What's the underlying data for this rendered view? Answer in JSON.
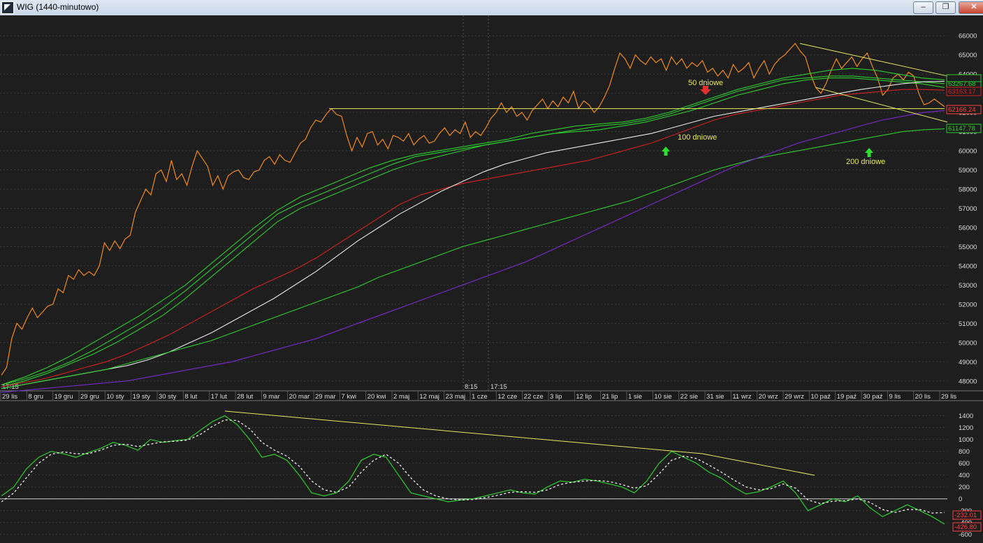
{
  "window": {
    "title": "WIG (1440-minutowo)",
    "minimize_label": "–",
    "restore_label": "❐",
    "close_label": "✕"
  },
  "chart_data": [
    {
      "type": "line",
      "yticks": [
        48000,
        49000,
        50000,
        51000,
        52000,
        53000,
        54000,
        55000,
        56000,
        57000,
        58000,
        59000,
        60000,
        61000,
        62000,
        63000,
        64000,
        65000,
        66000
      ],
      "ylim": [
        47700,
        66700
      ],
      "xlabels": [
        "29 lis",
        "8 gru",
        "19 gru",
        "29 gru",
        "10 sty",
        "19 sty",
        "30 sty",
        "8 lut",
        "17 lut",
        "28 lut",
        "9 mar",
        "20 mar",
        "29 mar",
        "7 kwi",
        "20 kwi",
        "2 maj",
        "12 maj",
        "23 maj",
        "1 cze",
        "12 cze",
        "22 cze",
        "3 lip",
        "12 lip",
        "21 lip",
        "1 sie",
        "10 sie",
        "22 sie",
        "31 sie",
        "11 wrz",
        "20 wrz",
        "29 wrz",
        "10 paź",
        "19 paź",
        "30 paź",
        "9 lis",
        "20 lis",
        "29 lis"
      ],
      "time_labels": [
        "17:15",
        "8:15",
        "17:15"
      ],
      "series": [
        {
          "key": "price",
          "color": "#f08a24",
          "values": [
            48300,
            48700,
            50200,
            51000,
            50700,
            51300,
            51800,
            51300,
            51600,
            51900,
            52000,
            52800,
            52600,
            53500,
            53300,
            53800,
            53500,
            53700,
            53500,
            54000,
            55200,
            54800,
            55300,
            54900,
            55400,
            55600,
            56800,
            57400,
            58000,
            57700,
            58800,
            59000,
            58400,
            59500,
            58500,
            58800,
            58200,
            59200,
            60000,
            59600,
            59200,
            58200,
            58700,
            58000,
            58700,
            58900,
            59000,
            58600,
            58500,
            58900,
            59000,
            59500,
            59700,
            59300,
            59800,
            59500,
            59400,
            59900,
            60400,
            60600,
            61200,
            61600,
            61500,
            61900,
            62200,
            61900,
            61800,
            60800,
            60000,
            60700,
            60200,
            60900,
            61000,
            60300,
            60600,
            60100,
            60800,
            60700,
            60500,
            60900,
            60300,
            60600,
            60800,
            60400,
            60500,
            60900,
            61200,
            60800,
            61100,
            60900,
            61500,
            60700,
            61000,
            60800,
            61200,
            61700,
            62000,
            62500,
            62000,
            62300,
            61800,
            62000,
            61600,
            62100,
            62400,
            62700,
            62200,
            62600,
            62300,
            62800,
            62500,
            63100,
            62200,
            62600,
            62400,
            62000,
            62300,
            62800,
            63400,
            64300,
            65100,
            64800,
            64300,
            65000,
            64700,
            64500,
            64900,
            64600,
            64800,
            64200,
            64900,
            64500,
            64800,
            64300,
            64600,
            64400,
            64700,
            64100,
            64300,
            63900,
            64200,
            63800,
            64500,
            64100,
            64300,
            64600,
            63800,
            64300,
            64700,
            64000,
            64500,
            64800,
            65000,
            65300,
            65600,
            65200,
            64900,
            64000,
            63300,
            63000,
            63500,
            64200,
            64800,
            64300,
            64600,
            64900,
            64400,
            64800,
            65100,
            64400,
            63800,
            62900,
            63200,
            63800,
            64000,
            63700,
            64100,
            63900,
            63000,
            62400,
            62500,
            62700,
            62500,
            62300
          ]
        },
        {
          "key": "ma-green-a",
          "color": "#2ecc2e",
          "values": [
            47800,
            48200,
            48700,
            49300,
            50000,
            50700,
            51400,
            52200,
            53000,
            54000,
            55000,
            56000,
            56900,
            57600,
            58100,
            58600,
            59100,
            59500,
            59800,
            60000,
            60200,
            60400,
            60600,
            60900,
            61100,
            61300,
            61400,
            61500,
            61700,
            62000,
            62400,
            62800,
            63200,
            63500,
            63800,
            64000,
            64200,
            64300,
            64200,
            64000,
            63800,
            63700
          ]
        },
        {
          "key": "ma-green-b",
          "color": "#2ecc2e",
          "values": [
            47800,
            48100,
            48500,
            49000,
            49600,
            50300,
            51000,
            51800,
            52700,
            53700,
            54700,
            55700,
            56700,
            57300,
            57800,
            58300,
            58800,
            59300,
            59700,
            59900,
            60100,
            60300,
            60500,
            60700,
            60900,
            61100,
            61300,
            61400,
            61600,
            61900,
            62300,
            62700,
            63100,
            63400,
            63700,
            63800,
            63900,
            63900,
            63800,
            63700,
            63600,
            63500
          ]
        },
        {
          "key": "ma-green-c",
          "color": "#2ecc2e",
          "values": [
            47700,
            48000,
            48400,
            48900,
            49400,
            50000,
            50700,
            51400,
            52300,
            53300,
            54300,
            55300,
            56300,
            57000,
            57500,
            58000,
            58500,
            59000,
            59400,
            59700,
            60000,
            60300,
            60500,
            60700,
            60900,
            61000,
            61100,
            61300,
            61500,
            61800,
            62100,
            62500,
            62900,
            63200,
            63500,
            63700,
            63800,
            63800,
            63700,
            63600,
            63500,
            63300
          ]
        },
        {
          "key": "ma-100-red",
          "color": "#d42020",
          "values": [
            47700,
            47900,
            48100,
            48400,
            48700,
            49000,
            49400,
            49900,
            50400,
            51000,
            51600,
            52200,
            52800,
            53300,
            53800,
            54400,
            55100,
            55800,
            56500,
            57200,
            57700,
            58000,
            58300,
            58500,
            58700,
            58900,
            59100,
            59300,
            59500,
            59800,
            60100,
            60400,
            60800,
            61200,
            61600,
            61900,
            62100,
            62300,
            62500,
            62700,
            62900,
            63000,
            63100,
            63200,
            63200,
            63163
          ]
        },
        {
          "key": "ma-white",
          "color": "#e8e8e8",
          "values": [
            47600,
            47800,
            48000,
            48200,
            48400,
            48600,
            48800,
            49100,
            49500,
            50000,
            50500,
            51100,
            51700,
            52300,
            53000,
            53700,
            54500,
            55300,
            56000,
            56700,
            57300,
            57900,
            58400,
            58900,
            59300,
            59600,
            59900,
            60100,
            60300,
            60500,
            60700,
            60900,
            61200,
            61500,
            61800,
            62000,
            62200,
            62400,
            62600,
            62800,
            63000,
            63200,
            63350,
            63500,
            63600,
            63620
          ]
        },
        {
          "key": "ma-200-green",
          "color": "#2ecc2e",
          "values": [
            47600,
            47800,
            48000,
            48200,
            48400,
            48600,
            48900,
            49200,
            49500,
            49800,
            50100,
            50500,
            50900,
            51300,
            51700,
            52100,
            52500,
            52900,
            53400,
            53800,
            54200,
            54600,
            55000,
            55300,
            55600,
            55900,
            56200,
            56500,
            56800,
            57100,
            57400,
            57800,
            58200,
            58600,
            59000,
            59300,
            59600,
            59800,
            60000,
            60200,
            60400,
            60600,
            60800,
            61000,
            61100,
            61147
          ]
        },
        {
          "key": "ma-purple",
          "color": "#7a2ad0",
          "values": [
            47400,
            47500,
            47600,
            47700,
            47800,
            47900,
            48000,
            48200,
            48400,
            48600,
            48800,
            49000,
            49300,
            49600,
            49900,
            50200,
            50600,
            51000,
            51400,
            51800,
            52200,
            52600,
            53000,
            53400,
            53800,
            54200,
            54700,
            55200,
            55700,
            56200,
            56700,
            57200,
            57700,
            58200,
            58700,
            59200,
            59600,
            60000,
            60400,
            60700,
            61000,
            61300,
            61600,
            61800,
            62000,
            62100
          ]
        }
      ],
      "lines": [
        {
          "key": "support-line",
          "color": "#e8e860",
          "y": 62200
        },
        {
          "key": "upper-trend",
          "color": "#e8e860",
          "from": [
            65600
          ],
          "to": [
            63900
          ]
        },
        {
          "key": "lower-trend",
          "color": "#e8e860",
          "from": [
            63300
          ],
          "to": [
            61500
          ]
        }
      ],
      "annotations": [
        {
          "key": "ma50",
          "text": "50 dniowe",
          "color": "#e8e860"
        },
        {
          "key": "ma100",
          "text": "100 dniowe",
          "color": "#e8e860"
        },
        {
          "key": "ma200",
          "text": "200 dniowe",
          "color": "#e8e860"
        }
      ],
      "value_labels": [
        {
          "text": "63267.68",
          "color": "#2ecc2e"
        },
        {
          "text": "63163.17",
          "color": "#d42020"
        },
        {
          "text": "62166.24",
          "color": "#ff4040"
        },
        {
          "text": "61147.78",
          "color": "#2ecc2e"
        }
      ]
    },
    {
      "type": "line",
      "yticks": [
        -600,
        -400,
        -200,
        0,
        200,
        400,
        600,
        800,
        1000,
        1200,
        1400
      ],
      "ylim": [
        -650,
        1560
      ],
      "series": [
        {
          "key": "macd",
          "color": "#2ecc2e",
          "values": [
            50,
            200,
            500,
            700,
            800,
            760,
            700,
            780,
            850,
            950,
            900,
            820,
            1000,
            950,
            980,
            1000,
            1150,
            1300,
            1400,
            1250,
            1000,
            700,
            750,
            650,
            400,
            100,
            50,
            100,
            300,
            650,
            750,
            700,
            400,
            100,
            50,
            0,
            -50,
            -20,
            0,
            50,
            100,
            150,
            100,
            80,
            200,
            300,
            280,
            330,
            300,
            250,
            200,
            100,
            300,
            600,
            800,
            700,
            600,
            450,
            350,
            200,
            80,
            120,
            200,
            300,
            100,
            -200,
            -100,
            0,
            -50,
            50,
            -150,
            -300,
            -200,
            -100,
            -200,
            -300,
            -427
          ]
        },
        {
          "key": "signal",
          "color": "#ffffff",
          "dashed": true,
          "values": [
            -50,
            100,
            350,
            600,
            750,
            790,
            760,
            760,
            820,
            900,
            920,
            880,
            920,
            960,
            970,
            990,
            1080,
            1220,
            1330,
            1320,
            1180,
            950,
            820,
            720,
            550,
            300,
            150,
            110,
            200,
            450,
            650,
            750,
            600,
            350,
            150,
            50,
            0,
            -20,
            -10,
            20,
            60,
            110,
            120,
            110,
            150,
            240,
            280,
            300,
            310,
            290,
            240,
            180,
            220,
            420,
            650,
            720,
            680,
            570,
            450,
            320,
            200,
            150,
            170,
            250,
            180,
            -20,
            -80,
            -40,
            -30,
            0,
            -60,
            -180,
            -230,
            -180,
            -180,
            -240,
            -232
          ]
        }
      ],
      "lines": [
        {
          "key": "osc-trend",
          "color": "#e8e860"
        }
      ],
      "value_labels": [
        {
          "text": "-232.01",
          "color": "#ff4040"
        },
        {
          "text": "-426.80",
          "color": "#ff4040"
        }
      ]
    }
  ]
}
